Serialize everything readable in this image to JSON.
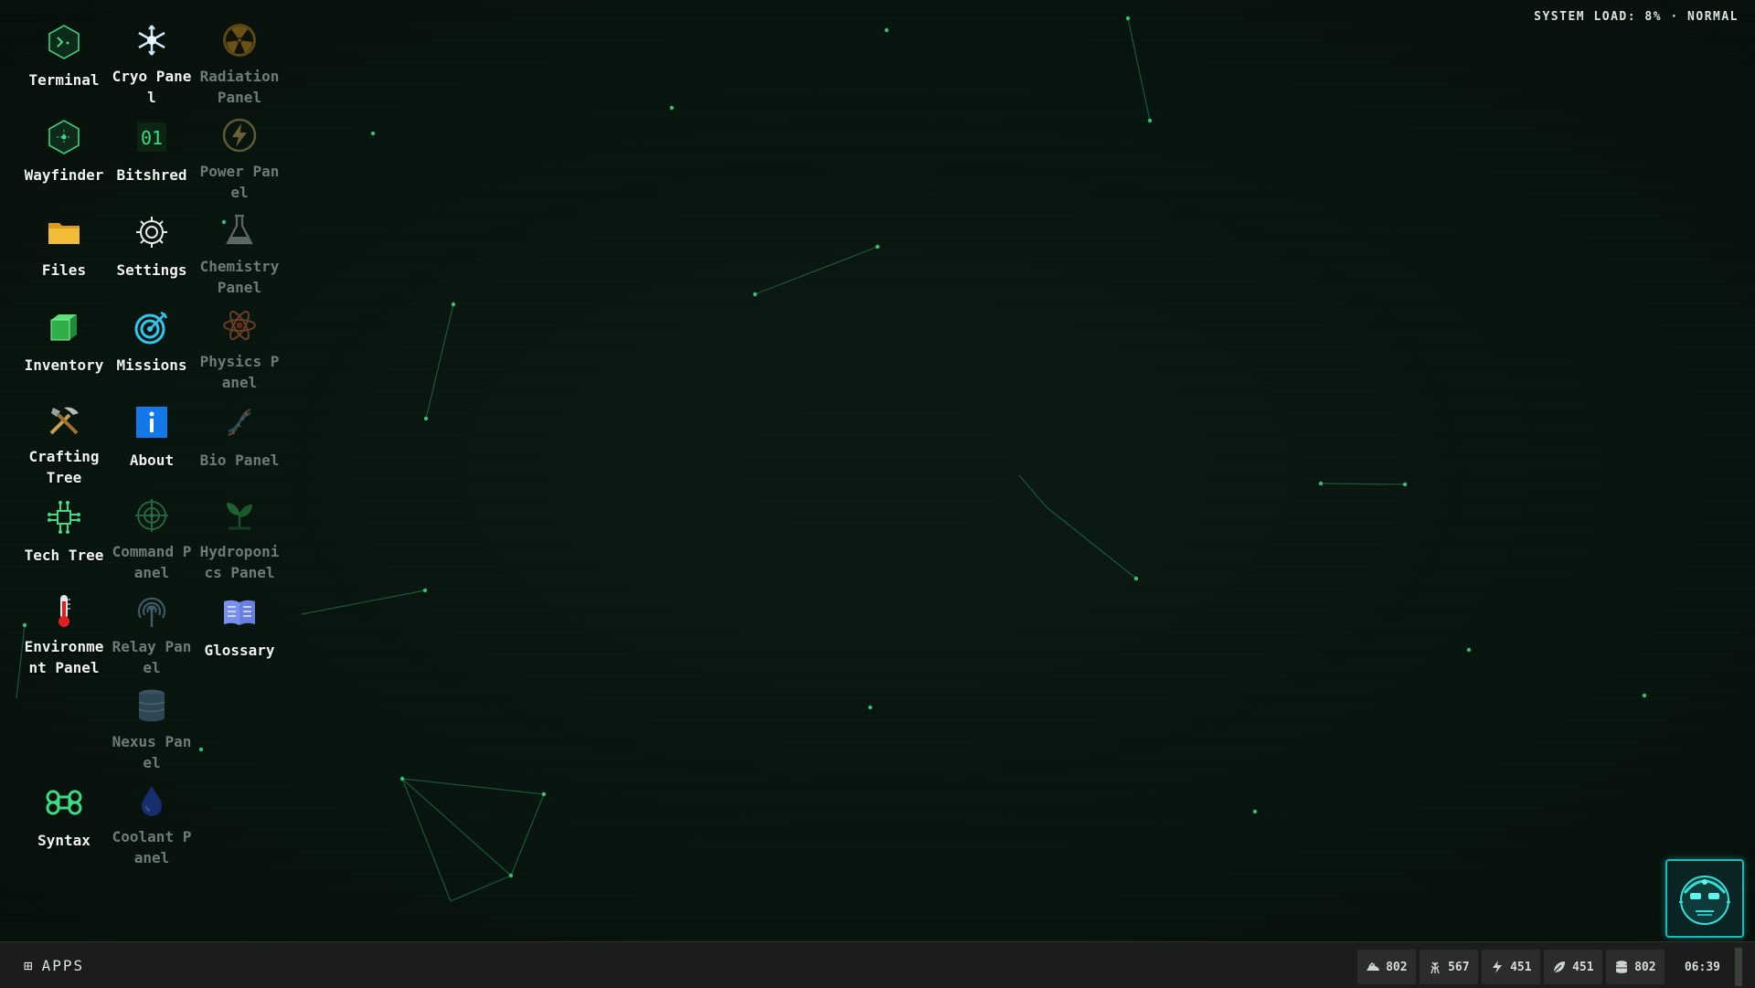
{
  "desktop": {
    "system_load": "SYSTEM LOAD: 8% · NORMAL",
    "icons": [
      {
        "id": "terminal",
        "label": "Terminal",
        "icon": "terminal-icon",
        "dim": false
      },
      {
        "id": "cryo-panel",
        "label": "Cryo Panel",
        "icon": "snowflake-icon",
        "dim": false
      },
      {
        "id": "radiation-panel",
        "label": "Radiation Panel",
        "icon": "radiation-icon",
        "dim": true
      },
      {
        "id": "wayfinder",
        "label": "Wayfinder",
        "icon": "compass-hex-icon",
        "dim": false
      },
      {
        "id": "bitshred",
        "label": "Bitshred",
        "icon": "binary-icon",
        "dim": false
      },
      {
        "id": "power-panel",
        "label": "Power Panel",
        "icon": "lightning-icon",
        "dim": true
      },
      {
        "id": "files",
        "label": "Files",
        "icon": "folder-icon",
        "dim": false
      },
      {
        "id": "settings",
        "label": "Settings",
        "icon": "gear-icon",
        "dim": false
      },
      {
        "id": "chemistry-panel",
        "label": "Chemistry Panel",
        "icon": "flask-icon",
        "dim": true
      },
      {
        "id": "inventory",
        "label": "Inventory",
        "icon": "cube-icon",
        "dim": false
      },
      {
        "id": "missions",
        "label": "Missions",
        "icon": "target-icon",
        "dim": false
      },
      {
        "id": "physics-panel",
        "label": "Physics Panel",
        "icon": "atom-icon",
        "dim": true
      },
      {
        "id": "crafting-tree",
        "label": "Crafting Tree",
        "icon": "tools-icon",
        "dim": false
      },
      {
        "id": "about",
        "label": "About",
        "icon": "info-icon",
        "dim": false
      },
      {
        "id": "bio-panel",
        "label": "Bio Panel",
        "icon": "dna-icon",
        "dim": true
      },
      {
        "id": "tech-tree",
        "label": "Tech Tree",
        "icon": "circuit-icon",
        "dim": false
      },
      {
        "id": "command-panel",
        "label": "Command Panel",
        "icon": "crosshair-icon",
        "dim": true
      },
      {
        "id": "hydroponics-panel",
        "label": "Hydroponics Panel",
        "icon": "plant-icon",
        "dim": true
      },
      {
        "id": "environment-panel",
        "label": "Environment Panel",
        "icon": "thermometer-icon",
        "dim": false
      },
      {
        "id": "relay-panel",
        "label": "Relay Panel",
        "icon": "antenna-icon",
        "dim": true
      },
      {
        "id": "glossary",
        "label": "Glossary",
        "icon": "book-icon",
        "dim": false
      },
      {
        "id": "nexus-panel",
        "label": "Nexus Panel",
        "icon": "database-icon",
        "dim": true
      },
      {
        "id": "syntax",
        "label": "Syntax",
        "icon": "command-key-icon",
        "dim": false
      },
      {
        "id": "coolant-panel",
        "label": "Coolant Panel",
        "icon": "droplet-icon",
        "dim": true
      }
    ]
  },
  "taskbar": {
    "apps_label": "APPS",
    "stats": [
      {
        "name": "ore",
        "icon": "ore-icon",
        "value": "802"
      },
      {
        "name": "crop",
        "icon": "wheat-icon",
        "value": "567"
      },
      {
        "name": "energy",
        "icon": "bolt-icon",
        "value": "451"
      },
      {
        "name": "biomass",
        "icon": "leaf-icon",
        "value": "451"
      },
      {
        "name": "data",
        "icon": "storage-icon",
        "value": "802"
      }
    ],
    "clock": "06:39"
  },
  "colors": {
    "accent": "#3ddc84",
    "avatar_border": "#1fb7b7",
    "taskbar": "#1b1d1c"
  }
}
